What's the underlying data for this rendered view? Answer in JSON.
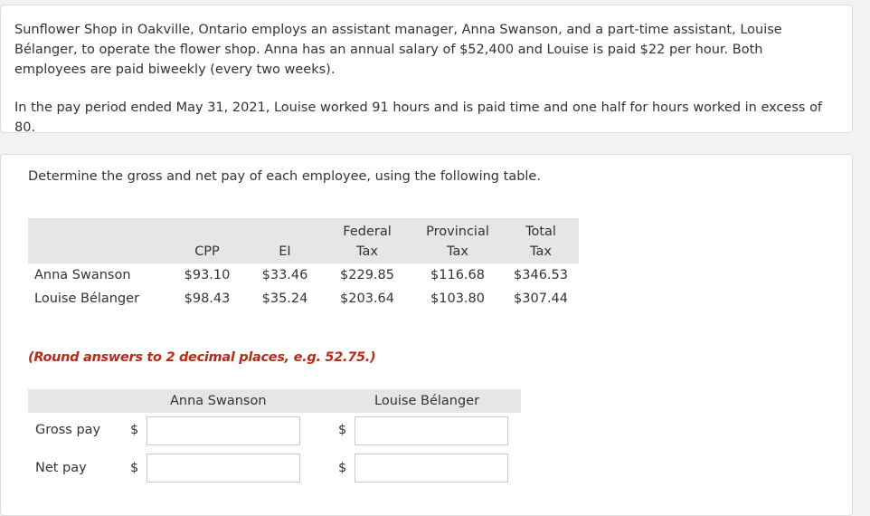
{
  "problem": {
    "paragraph1": "Sunflower Shop in Oakville, Ontario employs an assistant manager, Anna Swanson, and a part-time assistant, Louise Bélanger, to operate the flower shop. Anna has an annual salary of $52,400 and Louise is paid $22 per hour. Both employees are paid biweekly (every two weeks).",
    "paragraph2": "In the pay period ended May 31, 2021, Louise worked 91 hours and is paid time and one half for hours worked in excess of 80."
  },
  "question": {
    "instruction": "Determine the gross and net pay of each employee, using the following table.",
    "tax_table": {
      "headers": {
        "cpp": "CPP",
        "ei": "EI",
        "federal_line1": "Federal",
        "federal_line2": "Tax",
        "provincial_line1": "Provincial",
        "provincial_line2": "Tax",
        "total_line1": "Total",
        "total_line2": "Tax"
      },
      "rows": [
        {
          "name": "Anna Swanson",
          "cpp": "$93.10",
          "ei": "$33.46",
          "federal": "$229.85",
          "provincial": "$116.68",
          "total": "$346.53"
        },
        {
          "name": "Louise Bélanger",
          "cpp": "$98.43",
          "ei": "$35.24",
          "federal": "$203.64",
          "provincial": "$103.80",
          "total": "$307.44"
        }
      ]
    },
    "round_note": "(Round answers to 2 decimal places, e.g. 52.75.)",
    "answer_table": {
      "col_anna": "Anna Swanson",
      "col_louise": "Louise Bélanger",
      "currency": "$",
      "rows": [
        {
          "label": "Gross pay",
          "anna_value": "",
          "louise_value": ""
        },
        {
          "label": "Net pay",
          "anna_value": "",
          "louise_value": ""
        }
      ]
    }
  }
}
